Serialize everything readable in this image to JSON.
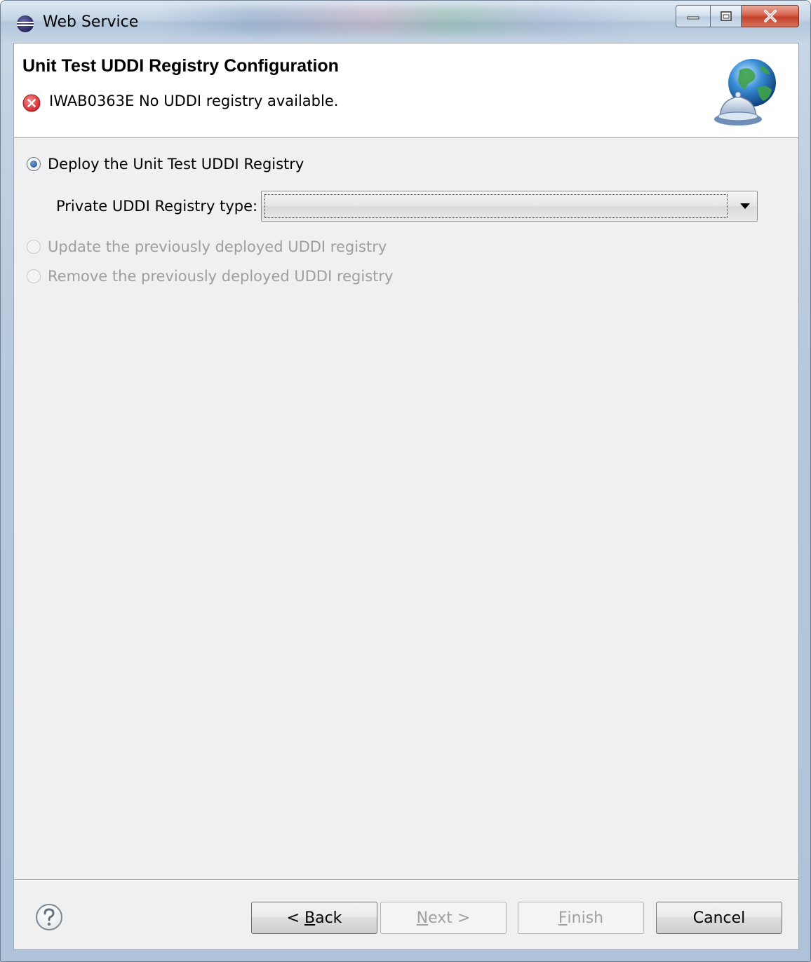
{
  "window": {
    "title": "Web Service",
    "controls": [
      "minimize",
      "maximize",
      "close"
    ]
  },
  "header": {
    "title": "Unit Test UDDI Registry Configuration",
    "error_message": "IWAB0363E No UDDI registry available."
  },
  "options": {
    "deploy": {
      "label": "Deploy the Unit Test UDDI Registry",
      "checked": true,
      "enabled": true
    },
    "registry_type_label": "Private UDDI Registry type:",
    "registry_type_value": "",
    "update": {
      "label": "Update the previously deployed UDDI registry",
      "checked": false,
      "enabled": false
    },
    "remove": {
      "label": "Remove the previously deployed UDDI registry",
      "checked": false,
      "enabled": false
    }
  },
  "footer": {
    "back_prefix": "< ",
    "back_mnemonic": "B",
    "back_rest": "ack",
    "next_mnemonic": "N",
    "next_rest": "ext >",
    "finish_mnemonic": "F",
    "finish_rest": "inish",
    "cancel_label": "Cancel"
  },
  "icons": {
    "app": "eclipse-icon",
    "error": "error-icon",
    "wizard": "globe-bell-icon",
    "help": "help-icon"
  },
  "colors": {
    "error_red": "#d9363e",
    "disabled_text": "#9e9e9e",
    "dialog_bg": "#f0f0f0"
  }
}
